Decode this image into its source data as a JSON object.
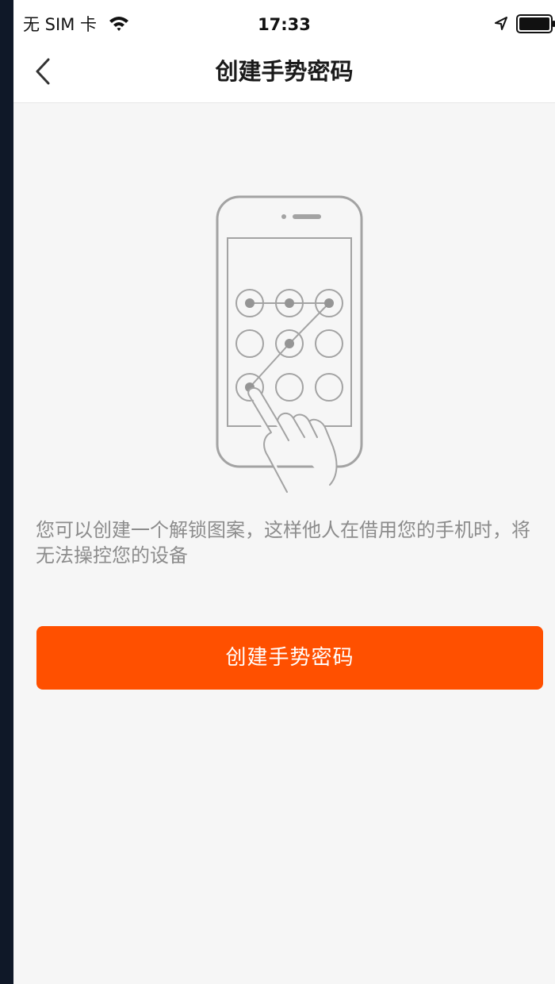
{
  "status_bar": {
    "carrier": "无 SIM 卡",
    "time": "17:33",
    "icons": [
      "wifi-icon",
      "location-arrow-icon",
      "battery-icon"
    ]
  },
  "nav": {
    "back_icon": "chevron-left-icon",
    "title": "创建手势密码"
  },
  "illustration": {
    "icon": "phone-gesture-pattern-illustration",
    "pattern": [
      1,
      2,
      3,
      5,
      7
    ]
  },
  "description": "您可以创建一个解锁图案，这样他人在借用您的手机时，将无法操控您的设备",
  "button": {
    "label": "创建手势密码"
  },
  "colors": {
    "accent": "#ff5000",
    "background": "#f6f6f6",
    "text_secondary": "#8c8c8c",
    "frame": "#0f1828"
  }
}
